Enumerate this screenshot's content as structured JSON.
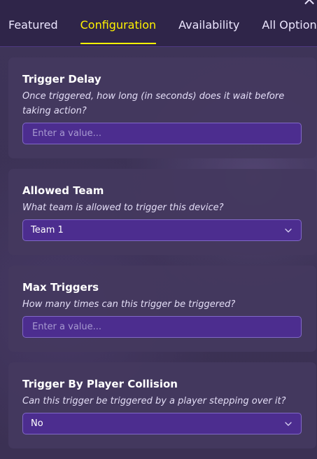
{
  "header": {
    "tabs": [
      {
        "label": "Featured",
        "active": false
      },
      {
        "label": "Configuration",
        "active": true
      },
      {
        "label": "Availability",
        "active": false
      },
      {
        "label": "All Options",
        "active": false
      }
    ],
    "close_icon": "close-icon"
  },
  "colors": {
    "accent": "#fff200",
    "field_bg": "#4c2d8f",
    "card_bg": "#44385f",
    "border": "#8168c7"
  },
  "cards": [
    {
      "title": "Trigger Delay",
      "description": "Once triggered, how long (in seconds) does it wait before taking action?",
      "field": {
        "type": "input",
        "value": "",
        "placeholder": "Enter a value..."
      }
    },
    {
      "title": "Allowed Team",
      "description": "What team is allowed to trigger this device?",
      "field": {
        "type": "select",
        "value": "Team 1"
      }
    },
    {
      "title": "Max Triggers",
      "description": "How many times can this trigger be triggered?",
      "field": {
        "type": "input",
        "value": "",
        "placeholder": "Enter a value..."
      }
    },
    {
      "title": "Trigger By Player Collision",
      "description": "Can this trigger be triggered by a player stepping over it?",
      "field": {
        "type": "select",
        "value": "No"
      }
    }
  ]
}
